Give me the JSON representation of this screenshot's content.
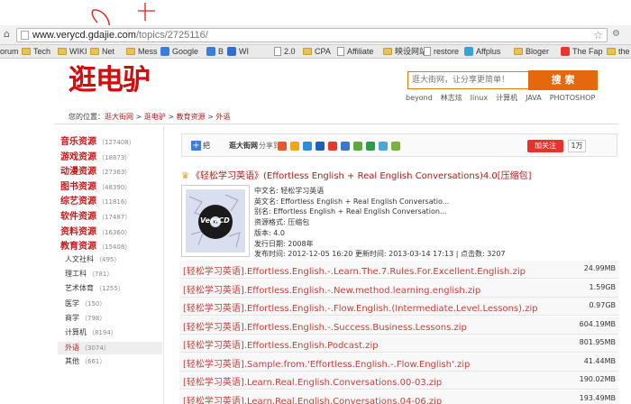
{
  "browser": {
    "url_host": "www.verycd.gdajie.com",
    "url_path": "/topics/2725116/",
    "bookmarks": [
      "orum",
      "Tech",
      "WIKI",
      "Net",
      "Mess",
      "Google",
      "B",
      "WI",
      "2.0",
      "CPA",
      "Affiliate",
      "映设网站",
      "restore",
      "Affplus",
      "Bloger",
      "The Fap",
      "the CP"
    ]
  },
  "site": {
    "logo": "逛电驴",
    "search_placeholder": "逛大街网，让分享更简单！",
    "search_button": "搜 索",
    "hot_words": [
      "beyond",
      "林志炫",
      "linux",
      "计算机",
      "JAVA",
      "PHOTOSHOP"
    ]
  },
  "breadcrumb": {
    "prefix": "您的位置：",
    "items": [
      "逛大街网",
      "逛电驴",
      "教育资源",
      "外语"
    ],
    "separator": " > "
  },
  "sidebar": {
    "categories": [
      {
        "label": "音乐资源",
        "count": "（127408）"
      },
      {
        "label": "游戏资源",
        "count": "（18873）"
      },
      {
        "label": "动漫资源",
        "count": "（27363）"
      },
      {
        "label": "图书资源",
        "count": "（48390）"
      },
      {
        "label": "综艺资源",
        "count": "（11816）"
      },
      {
        "label": "软件资源",
        "count": "（17487）"
      },
      {
        "label": "资料资源",
        "count": "（16360）"
      },
      {
        "label": "教育资源",
        "count": "（15408）"
      }
    ],
    "subcategories": [
      {
        "label": "人文社科",
        "count": "（495）"
      },
      {
        "label": "理工科",
        "count": "（781）"
      },
      {
        "label": "艺术体育",
        "count": "（1255）"
      },
      {
        "label": "医学",
        "count": "（150）"
      },
      {
        "label": "商学",
        "count": "（798）"
      },
      {
        "label": "计算机",
        "count": "（8194）"
      },
      {
        "label": "外语",
        "count": "（3074）"
      },
      {
        "label": "其他",
        "count": "（661）"
      }
    ]
  },
  "share": {
    "prefix": "把",
    "site": "逛大街网",
    "label": "分享到:",
    "follow": "加关注",
    "follow_count": "1万"
  },
  "topic": {
    "title": "《轻松学习英语》(Effortless English + Real English Conversations)4.0[压缩包]",
    "cover_text": "VeryCD",
    "info": [
      "中文名: 轻松学习英语",
      "英文名: Effortless English + Real English Conversatio...",
      "别名: Effortless English + Real English Conversation...",
      "资源格式: 压缩包",
      "版本: 4.0",
      "发行日期: 2008年",
      "发布时间: 2012-12-05 16:20 更新时间: 2013-03-14 17:13 | 点击数: 3207"
    ]
  },
  "files": [
    {
      "name": "[轻松学习英语].Effortless.English.-.Learn.The.7.Rules.For.Excellent.English.zip",
      "size": "24.99MB"
    },
    {
      "name": "[轻松学习英语].Effortless.English.-.New.method.learning.english.zip",
      "size": "1.59GB"
    },
    {
      "name": "[轻松学习英语].Effortless.English.-.Flow.English.(Intermediate.Level.Lessons).zip",
      "size": "0.97GB"
    },
    {
      "name": "[轻松学习英语].Effortless.English.-.Success.Business.Lessons.zip",
      "size": "604.19MB"
    },
    {
      "name": "[轻松学习英语].Effortless.English.Podcast.zip",
      "size": "801.95MB"
    },
    {
      "name": "[轻松学习英语].Sample.from.'Effortless.English.-.Flow.English'.zip",
      "size": "41.44MB"
    },
    {
      "name": "[轻松学习英语].Learn.Real.English.Conversations.00-03.zip",
      "size": "190.02MB"
    },
    {
      "name": "[轻松学习英语].Learn.Real.English.Conversations.04-06.zip",
      "size": "193.49MB"
    }
  ],
  "colors": {
    "brand_red": "#d20d0d",
    "accent_orange": "#e6680c",
    "link_red": "#c8403a"
  }
}
